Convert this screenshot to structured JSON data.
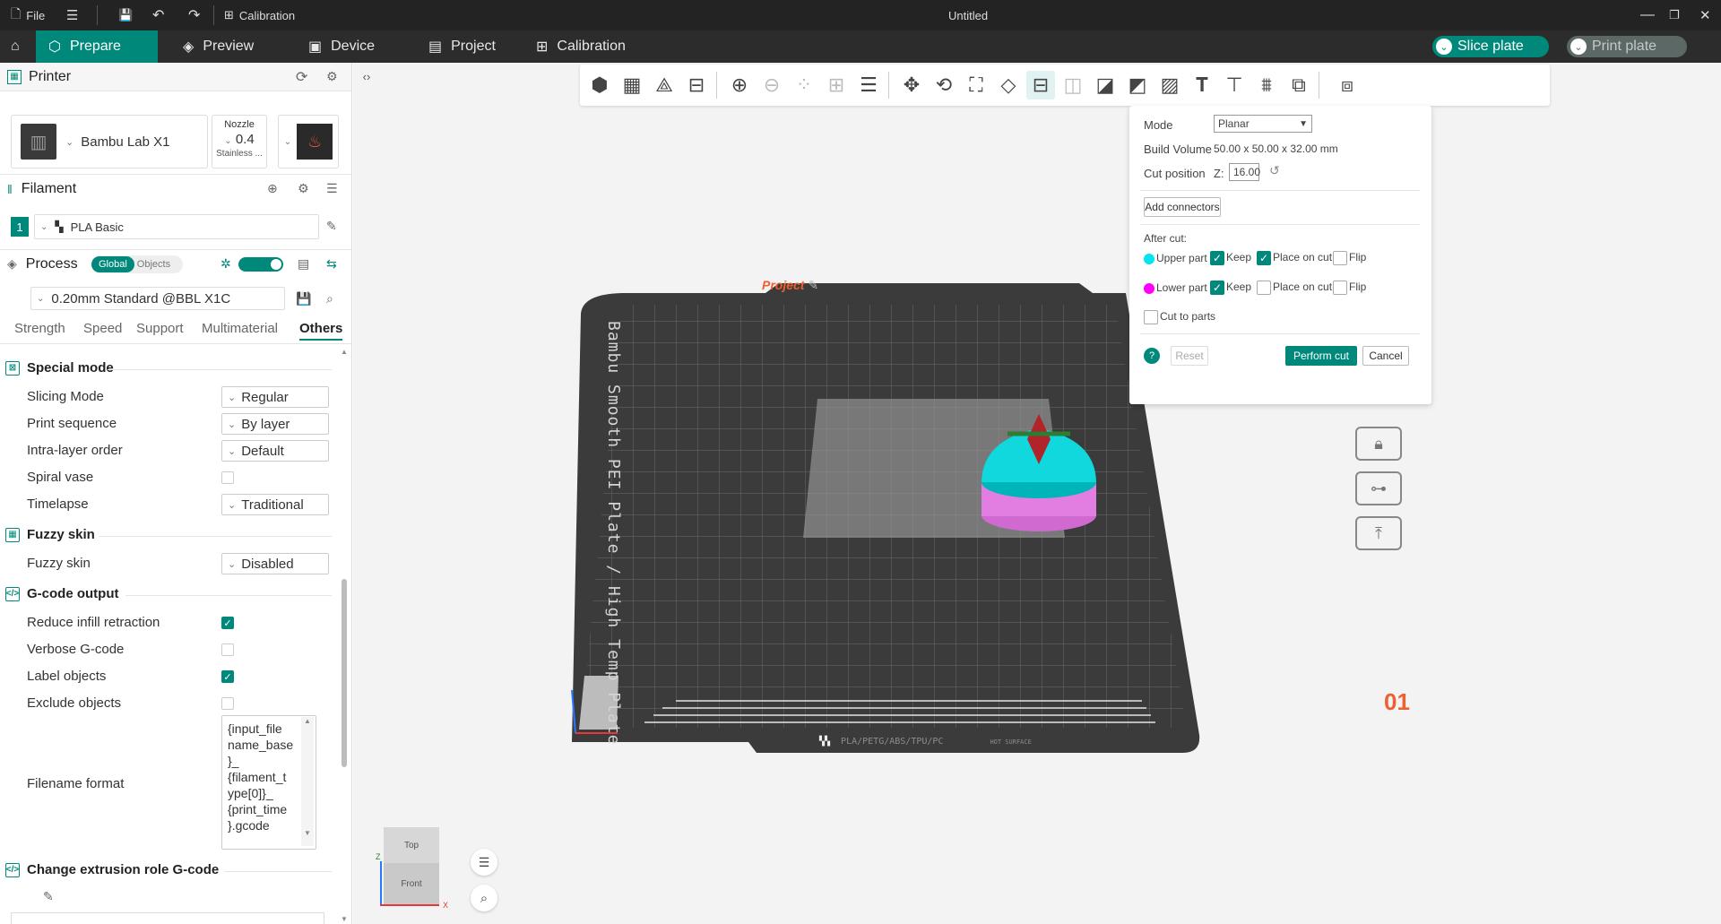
{
  "titlebar": {
    "file_label": "File",
    "calibration_label": "Calibration",
    "window_title": "Untitled"
  },
  "nav": {
    "tabs": [
      {
        "label": "Prepare",
        "icon": "cube-icon"
      },
      {
        "label": "Preview",
        "icon": "layers-icon"
      },
      {
        "label": "Device",
        "icon": "device-icon"
      },
      {
        "label": "Project",
        "icon": "project-icon"
      },
      {
        "label": "Calibration",
        "icon": "calibration-icon"
      }
    ],
    "slice_label": "Slice plate",
    "print_label": "Print plate"
  },
  "printer": {
    "section_title": "Printer",
    "name": "Bambu Lab X1",
    "nozzle_label": "Nozzle",
    "nozzle_value": "0.4",
    "nozzle_type": "Stainless ..."
  },
  "filament": {
    "section_title": "Filament",
    "slot_number": "1",
    "name": "PLA Basic"
  },
  "process": {
    "section_title": "Process",
    "toggle_global": "Global",
    "toggle_objects": "Objects",
    "preset": "0.20mm Standard @BBL X1C",
    "tabs": [
      "Strength",
      "Speed",
      "Support",
      "Multimaterial",
      "Others"
    ],
    "active_tab": "Others"
  },
  "settings": {
    "special_mode": {
      "title": "Special mode",
      "slicing_mode_label": "Slicing Mode",
      "slicing_mode_value": "Regular",
      "print_sequence_label": "Print sequence",
      "print_sequence_value": "By layer",
      "intra_layer_label": "Intra-layer order",
      "intra_layer_value": "Default",
      "spiral_vase_label": "Spiral vase",
      "timelapse_label": "Timelapse",
      "timelapse_value": "Traditional"
    },
    "fuzzy_skin": {
      "title": "Fuzzy skin",
      "fuzzy_label": "Fuzzy skin",
      "fuzzy_value": "Disabled"
    },
    "gcode_output": {
      "title": "G-code output",
      "reduce_infill_label": "Reduce infill retraction",
      "verbose_label": "Verbose G-code",
      "label_objects_label": "Label objects",
      "exclude_objects_label": "Exclude objects",
      "filename_format_label": "Filename format",
      "filename_format_value": "{input_file\nname_base\n}_\n{filament_t\nype[0]}_\n{print_time\n}.gcode"
    },
    "change_extrusion": {
      "title": "Change extrusion role G-code"
    }
  },
  "plate": {
    "project_label": "Project",
    "plate_text": "Bambu Smooth PEI Plate / High Temp Plate",
    "plate_number": "01",
    "bottom_strip": "PLA/PETG/ABS/TPU/PC",
    "hot_surface": "HOT SURFACE"
  },
  "cut": {
    "mode_label": "Mode",
    "mode_value": "Planar",
    "build_volume_label": "Build Volume",
    "build_volume_value": "50.00 x 50.00 x 32.00 mm",
    "cut_position_label": "Cut position",
    "z_label": "Z:",
    "z_value": "16.00",
    "add_connectors_label": "Add connectors",
    "after_cut_label": "After cut:",
    "upper_part_label": "Upper part",
    "lower_part_label": "Lower part",
    "keep_label": "Keep",
    "place_on_cut_label": "Place on cut",
    "flip_label": "Flip",
    "cut_to_parts_label": "Cut to parts",
    "reset_label": "Reset",
    "perform_label": "Perform cut",
    "cancel_label": "Cancel",
    "upper_color": "#00e5ee",
    "lower_color": "#ff00ff"
  },
  "viewcube": {
    "top_label": "Top",
    "front_label": "Front",
    "z_axis": "Z",
    "x_axis": "X"
  },
  "colors": {
    "accent": "#00897b",
    "plate_number": "#ee5f32"
  }
}
